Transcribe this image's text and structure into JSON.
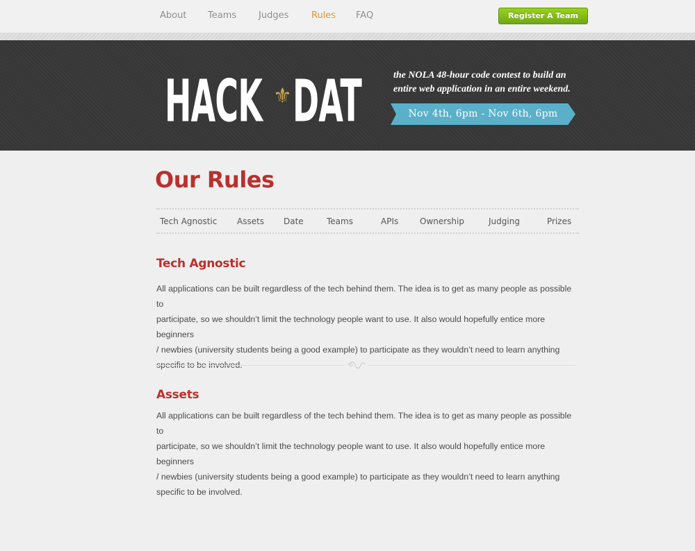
{
  "nav": {
    "items": [
      {
        "label": "About"
      },
      {
        "label": "Teams"
      },
      {
        "label": "Judges"
      },
      {
        "label": "Rules"
      },
      {
        "label": "FAQ"
      }
    ],
    "active": "Rules",
    "register_label": "Register A Team"
  },
  "banner": {
    "logo_left": "HACK",
    "logo_right": "DAT",
    "logo_symbol": "fleur-de-lis-icon",
    "tagline_line1": "the NOLA 48-hour code contest to build  an",
    "tagline_line2": "entire web application in an entire weekend.",
    "dates": "Nov 4th, 6pm - Nov 6th, 6pm"
  },
  "page": {
    "title": "Our Rules"
  },
  "rules_nav": {
    "tabs": [
      {
        "label": "Tech Agnostic"
      },
      {
        "label": "Assets"
      },
      {
        "label": "Date"
      },
      {
        "label": "Teams"
      },
      {
        "label": "APIs"
      },
      {
        "label": "Ownership"
      },
      {
        "label": "Judging"
      },
      {
        "label": "Prizes"
      }
    ]
  },
  "sections": [
    {
      "heading": "Tech Agnostic",
      "lines": [
        "All applications can be built regardless of the tech behind them.  The idea is to get as many people as possible to",
        "participate, so we shouldn’t limit the technology people want to use.  It also would hopefully entice more beginners",
        "/ newbies (university students being a good example) to participate as they wouldn’t need to learn anything",
        "specific to be involved."
      ]
    },
    {
      "heading": "Assets",
      "lines": [
        "All applications can be built regardless of the tech behind them.  The idea is to get as many people as possible to",
        "participate, so we shouldn’t limit the technology people want to use.  It also would hopefully entice more beginners",
        "/ newbies (university students being a good example) to participate as they wouldn’t need to learn anything",
        "specific to be involved."
      ]
    }
  ],
  "colors": {
    "accent_red": "#b8312e",
    "nav_active": "#d8912a",
    "register_green": "#7fbb18",
    "ribbon_blue": "#5ab0c9",
    "banner_dark": "#363636"
  }
}
